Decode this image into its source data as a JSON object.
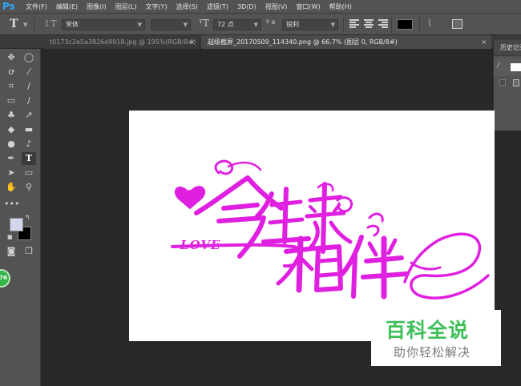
{
  "app": {
    "logo": "Ps"
  },
  "menu": [
    "文件(F)",
    "编辑(E)",
    "图像(I)",
    "图层(L)",
    "文字(Y)",
    "选择(S)",
    "滤镜(T)",
    "3D(D)",
    "视图(V)",
    "窗口(W)",
    "帮助(H)"
  ],
  "options": {
    "tool_icon": "T",
    "font_family": "宋体",
    "font_style": "",
    "font_size": "72 点",
    "antialias_label": "ª a",
    "antialias_value": "锐利",
    "text_color": "#000000"
  },
  "tabs": [
    {
      "label": "t0173c2e5a3826e9918.jpg @ 195%(RGB/8#)",
      "close": "×"
    },
    {
      "label": "超级截屏_20170509_114340.png @ 66.7% (图层 0, RGB/8#)",
      "close": "×"
    }
  ],
  "history_panel": {
    "title": "历史记录"
  },
  "toolbar": {
    "badge": "76"
  },
  "canvas": {
    "love_text": "LOVE",
    "artwork_color": "#e020e0"
  },
  "watermark": {
    "title": "百科全说",
    "subtitle": "助你轻松解决"
  }
}
